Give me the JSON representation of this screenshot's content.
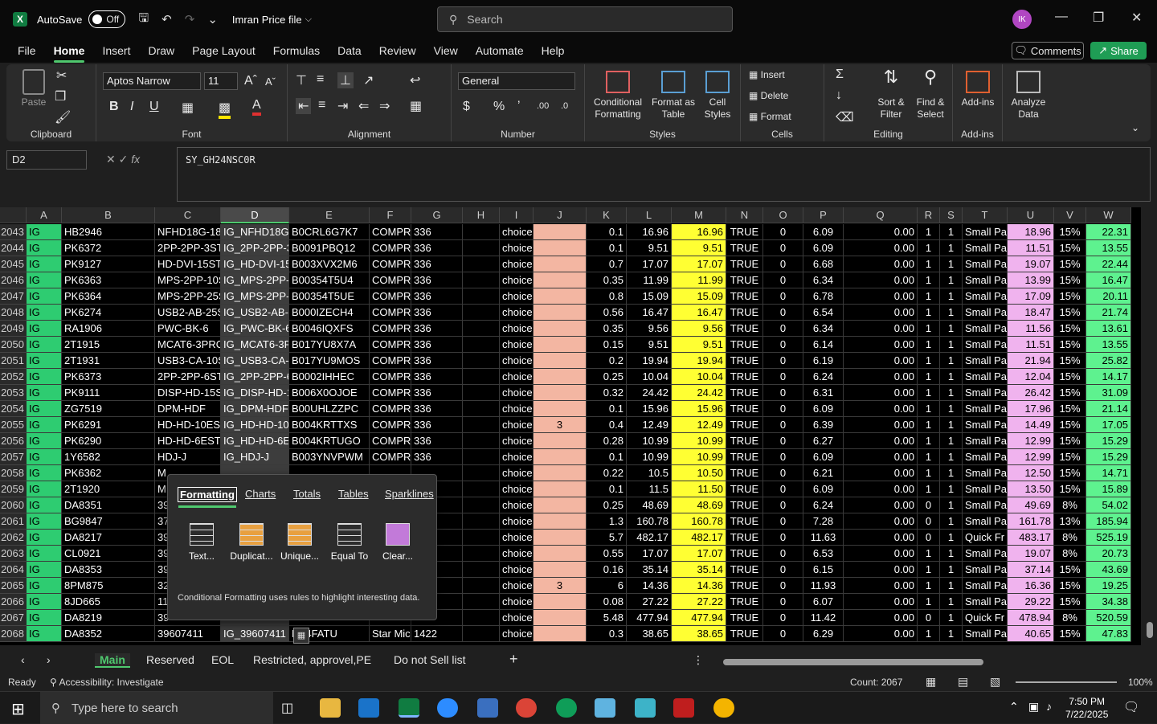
{
  "titlebar": {
    "app_logo": "X",
    "autosave_label": "AutoSave",
    "autosave_state": "Off",
    "filename": "Imran Price file",
    "search_placeholder": "Search",
    "avatar_initials": "IK"
  },
  "menu": [
    "File",
    "Home",
    "Insert",
    "Draw",
    "Page Layout",
    "Formulas",
    "Data",
    "Review",
    "View",
    "Automate",
    "Help"
  ],
  "menu_active": "Home",
  "comments_label": "Comments",
  "share_label": "Share",
  "ribbon": {
    "paste": "Paste",
    "font_name": "Aptos Narrow",
    "font_size": "11",
    "number_format": "General",
    "cond_format_1": "Conditional",
    "cond_format_2": "Formatting",
    "format_table_1": "Format as",
    "format_table_2": "Table",
    "cell_styles_1": "Cell",
    "cell_styles_2": "Styles",
    "insert": "Insert",
    "delete": "Delete",
    "format": "Format",
    "sort_1": "Sort &",
    "sort_2": "Filter",
    "find_1": "Find &",
    "find_2": "Select",
    "addins": "Add-ins",
    "analyze_1": "Analyze",
    "analyze_2": "Data",
    "groups": {
      "clipboard": "Clipboard",
      "font": "Font",
      "alignment": "Alignment",
      "number": "Number",
      "styles": "Styles",
      "cells": "Cells",
      "editing": "Editing",
      "addins": "Add-ins"
    }
  },
  "namebox": "D2",
  "formula": "SY_GH24NSC0R",
  "columns": [
    "A",
    "B",
    "C",
    "D",
    "E",
    "F",
    "G",
    "H",
    "I",
    "J",
    "K",
    "L",
    "M",
    "N",
    "O",
    "P",
    "Q",
    "R",
    "S",
    "T",
    "U",
    "V",
    "W"
  ],
  "rows": [
    [
      "2043",
      "IG",
      "HB2946",
      "NFHD18G-18",
      "IG_NFHD18G-",
      "B0CRL6G7K7",
      "COMPRE",
      "336",
      "",
      "choice",
      "",
      "0.1",
      "16.96",
      "16.96",
      "TRUE",
      "0",
      "6.09",
      "0.00",
      "1",
      "1",
      "Small Pa",
      "18.96",
      "15%",
      "22.31"
    ],
    [
      "2044",
      "IG",
      "PK6372",
      "2PP-2PP-3ST",
      "IG_2PP-2PP-3",
      "B0091PBQ12",
      "COMPRE",
      "336",
      "",
      "choice",
      "",
      "0.1",
      "9.51",
      "9.51",
      "TRUE",
      "0",
      "6.09",
      "0.00",
      "1",
      "1",
      "Small Pa",
      "11.51",
      "15%",
      "13.55"
    ],
    [
      "2045",
      "IG",
      "PK9127",
      "HD-DVI-15ST",
      "IG_HD-DVI-15",
      "B003XVX2M6",
      "COMPRE",
      "336",
      "",
      "choice",
      "",
      "0.7",
      "17.07",
      "17.07",
      "TRUE",
      "0",
      "6.68",
      "0.00",
      "1",
      "1",
      "Small Pa",
      "19.07",
      "15%",
      "22.44"
    ],
    [
      "2046",
      "IG",
      "PK6363",
      "MPS-2PP-10S",
      "IG_MPS-2PP-1",
      "B00354T5U4",
      "COMPRE",
      "336",
      "",
      "choice",
      "",
      "0.35",
      "11.99",
      "11.99",
      "TRUE",
      "0",
      "6.34",
      "0.00",
      "1",
      "1",
      "Small Pa",
      "13.99",
      "15%",
      "16.47"
    ],
    [
      "2047",
      "IG",
      "PK6364",
      "MPS-2PP-25S",
      "IG_MPS-2PP-2",
      "B00354T5UE",
      "COMPRE",
      "336",
      "",
      "choice",
      "",
      "0.8",
      "15.09",
      "15.09",
      "TRUE",
      "0",
      "6.78",
      "0.00",
      "1",
      "1",
      "Small Pa",
      "17.09",
      "15%",
      "20.11"
    ],
    [
      "2048",
      "IG",
      "PK6274",
      "USB2-AB-25S",
      "IG_USB2-AB-2",
      "B000IZECH4",
      "COMPRE",
      "336",
      "",
      "choice",
      "",
      "0.56",
      "16.47",
      "16.47",
      "TRUE",
      "0",
      "6.54",
      "0.00",
      "1",
      "1",
      "Small Pa",
      "18.47",
      "15%",
      "21.74"
    ],
    [
      "2049",
      "IG",
      "RA1906",
      "PWC-BK-6",
      "IG_PWC-BK-6",
      "B0046IQXFS",
      "COMPRE",
      "336",
      "",
      "choice",
      "",
      "0.35",
      "9.56",
      "9.56",
      "TRUE",
      "0",
      "6.34",
      "0.00",
      "1",
      "1",
      "Small Pa",
      "11.56",
      "15%",
      "13.61"
    ],
    [
      "2050",
      "IG",
      "2T1915",
      "MCAT6-3PRO",
      "IG_MCAT6-3P",
      "B017YU8X7A",
      "COMPRE",
      "336",
      "",
      "choice",
      "",
      "0.15",
      "9.51",
      "9.51",
      "TRUE",
      "0",
      "6.14",
      "0.00",
      "1",
      "1",
      "Small Pa",
      "11.51",
      "15%",
      "13.55"
    ],
    [
      "2051",
      "IG",
      "2T1931",
      "USB3-CA-10S",
      "IG_USB3-CA-1",
      "B017YU9MOS",
      "COMPRE",
      "336",
      "",
      "choice",
      "",
      "0.2",
      "19.94",
      "19.94",
      "TRUE",
      "0",
      "6.19",
      "0.00",
      "1",
      "1",
      "Small Pa",
      "21.94",
      "15%",
      "25.82"
    ],
    [
      "2052",
      "IG",
      "PK6373",
      "2PP-2PP-6ST",
      "IG_2PP-2PP-6",
      "B0002IHHEC",
      "COMPRE",
      "336",
      "",
      "choice",
      "",
      "0.25",
      "10.04",
      "10.04",
      "TRUE",
      "0",
      "6.24",
      "0.00",
      "1",
      "1",
      "Small Pa",
      "12.04",
      "15%",
      "14.17"
    ],
    [
      "2053",
      "IG",
      "PK9111",
      "DISP-HD-15S",
      "IG_DISP-HD-1",
      "B006X0OJOE",
      "COMPRE",
      "336",
      "",
      "choice",
      "",
      "0.32",
      "24.42",
      "24.42",
      "TRUE",
      "0",
      "6.31",
      "0.00",
      "1",
      "1",
      "Small Pa",
      "26.42",
      "15%",
      "31.09"
    ],
    [
      "2054",
      "IG",
      "ZG7519",
      "DPM-HDF",
      "IG_DPM-HDF",
      "B00UHLZZPC",
      "COMPRE",
      "336",
      "",
      "choice",
      "",
      "0.1",
      "15.96",
      "15.96",
      "TRUE",
      "0",
      "6.09",
      "0.00",
      "1",
      "1",
      "Small Pa",
      "17.96",
      "15%",
      "21.14"
    ],
    [
      "2055",
      "IG",
      "PK6291",
      "HD-HD-10EST",
      "IG_HD-HD-10",
      "B004KRTTXS",
      "COMPRE",
      "336",
      "",
      "choice",
      "3",
      "0.4",
      "12.49",
      "12.49",
      "TRUE",
      "0",
      "6.39",
      "0.00",
      "1",
      "1",
      "Small Pa",
      "14.49",
      "15%",
      "17.05"
    ],
    [
      "2056",
      "IG",
      "PK6290",
      "HD-HD-6EST",
      "IG_HD-HD-6E",
      "B004KRTUGO",
      "COMPRE",
      "336",
      "",
      "choice",
      "",
      "0.28",
      "10.99",
      "10.99",
      "TRUE",
      "0",
      "6.27",
      "0.00",
      "1",
      "1",
      "Small Pa",
      "12.99",
      "15%",
      "15.29"
    ],
    [
      "2057",
      "IG",
      "1Y6582",
      "HDJ-J",
      "IG_HDJ-J",
      "B003YNVPWM",
      "COMPRE",
      "336",
      "",
      "choice",
      "",
      "0.1",
      "10.99",
      "10.99",
      "TRUE",
      "0",
      "6.09",
      "0.00",
      "1",
      "1",
      "Small Pa",
      "12.99",
      "15%",
      "15.29"
    ],
    [
      "2058",
      "IG",
      "PK6362",
      "M",
      "",
      "",
      "",
      "",
      "",
      "choice",
      "",
      "0.22",
      "10.5",
      "10.50",
      "TRUE",
      "0",
      "6.21",
      "0.00",
      "1",
      "1",
      "Small Pa",
      "12.50",
      "15%",
      "14.71"
    ],
    [
      "2059",
      "IG",
      "2T1920",
      "M",
      "",
      "",
      "",
      "",
      "",
      "choice",
      "",
      "0.1",
      "11.5",
      "11.50",
      "TRUE",
      "0",
      "6.09",
      "0.00",
      "1",
      "1",
      "Small Pa",
      "13.50",
      "15%",
      "15.89"
    ],
    [
      "2060",
      "IG",
      "DA8351",
      "39",
      "",
      "",
      "",
      "",
      "",
      "choice",
      "",
      "0.25",
      "48.69",
      "48.69",
      "TRUE",
      "0",
      "6.24",
      "0.00",
      "0",
      "1",
      "Small Pa",
      "49.69",
      "8%",
      "54.02"
    ],
    [
      "2061",
      "IG",
      "BG9847",
      "37",
      "",
      "",
      "",
      "",
      "",
      "choice",
      "",
      "1.3",
      "160.78",
      "160.78",
      "TRUE",
      "0",
      "7.28",
      "0.00",
      "0",
      "1",
      "Small Pa",
      "161.78",
      "13%",
      "185.94"
    ],
    [
      "2062",
      "IG",
      "DA8217",
      "39",
      "",
      "",
      "",
      "",
      "",
      "choice",
      "",
      "5.7",
      "482.17",
      "482.17",
      "TRUE",
      "0",
      "11.63",
      "0.00",
      "0",
      "1",
      "Quick Fr",
      "483.17",
      "8%",
      "525.19"
    ],
    [
      "2063",
      "IG",
      "CL0921",
      "39",
      "",
      "",
      "",
      "",
      "",
      "choice",
      "",
      "0.55",
      "17.07",
      "17.07",
      "TRUE",
      "0",
      "6.53",
      "0.00",
      "1",
      "1",
      "Small Pa",
      "19.07",
      "8%",
      "20.73"
    ],
    [
      "2064",
      "IG",
      "DA8353",
      "39",
      "",
      "",
      "",
      "",
      "",
      "choice",
      "",
      "0.16",
      "35.14",
      "35.14",
      "TRUE",
      "0",
      "6.15",
      "0.00",
      "1",
      "1",
      "Small Pa",
      "37.14",
      "15%",
      "43.69"
    ],
    [
      "2065",
      "IG",
      "8PM875",
      "32",
      "",
      "",
      "",
      "",
      "",
      "choice",
      "3",
      "6",
      "14.36",
      "14.36",
      "TRUE",
      "0",
      "11.93",
      "0.00",
      "1",
      "1",
      "Small Pa",
      "16.36",
      "15%",
      "19.25"
    ],
    [
      "2066",
      "IG",
      "8JD665",
      "11",
      "",
      "",
      "",
      "",
      "",
      "choice",
      "",
      "0.08",
      "27.22",
      "27.22",
      "TRUE",
      "0",
      "6.07",
      "0.00",
      "1",
      "1",
      "Small Pa",
      "29.22",
      "15%",
      "34.38"
    ],
    [
      "2067",
      "IG",
      "DA8219",
      "39",
      "",
      "",
      "",
      "",
      "",
      "choice",
      "",
      "5.48",
      "477.94",
      "477.94",
      "TRUE",
      "0",
      "11.42",
      "0.00",
      "0",
      "1",
      "Quick Fr",
      "478.94",
      "8%",
      "520.59"
    ],
    [
      "2068",
      "IG",
      "DA8352",
      "39607411",
      "IG_39607411",
      "BP4FATU",
      "Star Mic",
      "1422",
      "",
      "choice",
      "",
      "0.3",
      "38.65",
      "38.65",
      "TRUE",
      "0",
      "6.29",
      "0.00",
      "1",
      "1",
      "Small Pa",
      "40.65",
      "15%",
      "47.83"
    ]
  ],
  "quick_analysis": {
    "tabs": [
      "Formatting",
      "Charts",
      "Totals",
      "Tables",
      "Sparklines"
    ],
    "options": [
      "Text...",
      "Duplicat...",
      "Unique...",
      "Equal To",
      "Clear..."
    ],
    "description": "Conditional Formatting uses rules to highlight interesting data."
  },
  "sheets": [
    "Main",
    "Reserved",
    "EOL",
    "Restricted, approvel,PE",
    "Do not Sell list"
  ],
  "sheet_active": "Main",
  "status": {
    "ready": "Ready",
    "accessibility": "Accessibility: Investigate",
    "count": "Count: 2067",
    "zoom": "100%"
  },
  "taskbar": {
    "search_placeholder": "Type here to search",
    "time": "7:50 PM",
    "date": "7/22/2025"
  }
}
